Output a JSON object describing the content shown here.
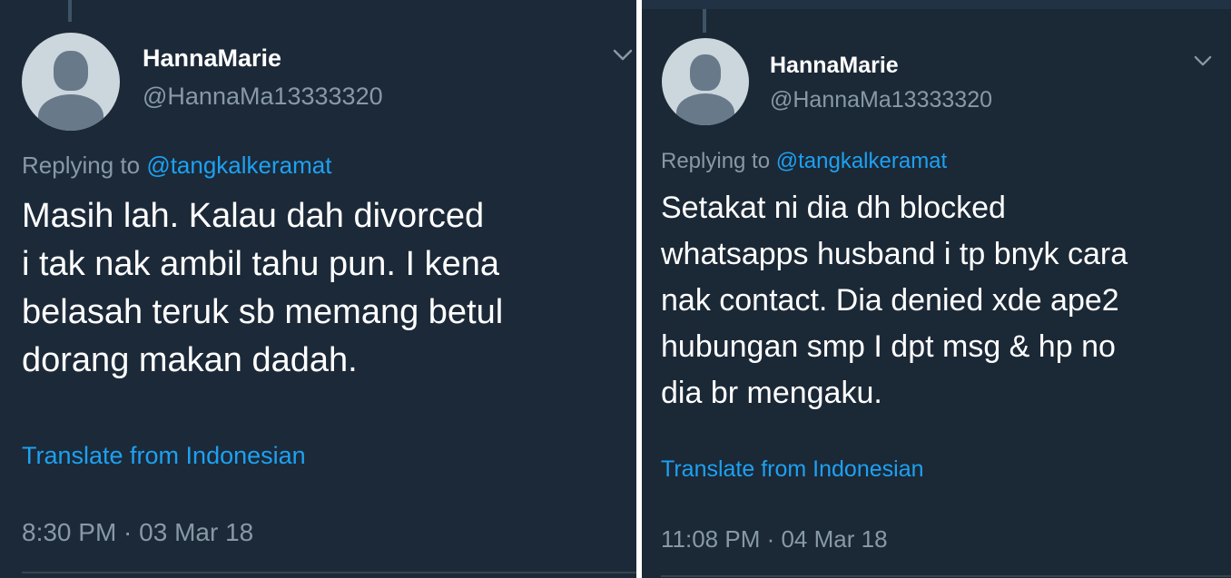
{
  "tweets": [
    {
      "name": "HannaMarie",
      "handle": "@HannaMa13333320",
      "replying_prefix": "Replying to ",
      "replying_to": "@tangkalkeramat",
      "text_lines": [
        "Masih lah. Kalau dah divorced",
        "i tak nak ambil tahu pun. I kena",
        "belasah teruk sb memang betul",
        "dorang makan dadah."
      ],
      "translate_label": "Translate from Indonesian",
      "timestamp": "8:30 PM · 03 Mar 18",
      "menu_icon": "chevron-down-icon",
      "avatar_icon": "default-avatar-icon"
    },
    {
      "name": "HannaMarie",
      "handle": "@HannaMa13333320",
      "replying_prefix": "Replying to ",
      "replying_to": "@tangkalkeramat",
      "text_lines": [
        "Setakat ni dia dh blocked",
        "whatsapps husband i tp bnyk cara",
        "nak contact. Dia denied xde ape2",
        "hubungan smp I dpt msg & hp no",
        "dia br mengaku."
      ],
      "translate_label": "Translate from Indonesian",
      "timestamp": "11:08 PM · 04 Mar 18",
      "menu_icon": "chevron-down-icon",
      "avatar_icon": "default-avatar-icon"
    }
  ],
  "colors": {
    "background": "#1b2836",
    "text": "#ffffff",
    "secondary_text": "#8899a6",
    "link": "#1da1f2",
    "avatar_bg": "#ccd6dd",
    "avatar_fg": "#68798a"
  }
}
